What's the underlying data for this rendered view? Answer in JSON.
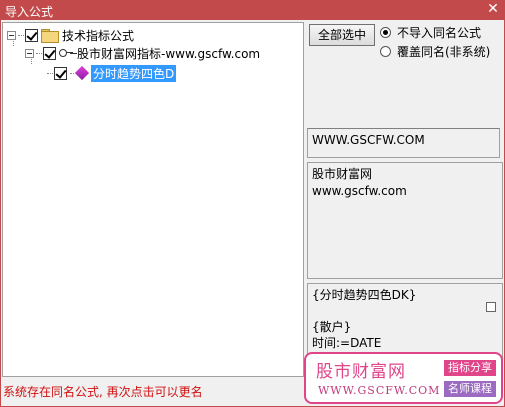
{
  "window": {
    "title": "导入公式",
    "close_glyph": "✕"
  },
  "tree": {
    "items": [
      {
        "label": "技术指标公式",
        "checked": true,
        "icon": "folder-icon"
      },
      {
        "label": "股市财富网指标-www.gscfw.com",
        "checked": true,
        "icon": "key-icon"
      },
      {
        "label": "分时趋势四色D",
        "checked": true,
        "icon": "gem-icon",
        "selected": true
      }
    ]
  },
  "actions": {
    "select_all_label": "全部选中"
  },
  "options": [
    {
      "label": "不导入同名公式",
      "selected": true
    },
    {
      "label": "覆盖同名(非系统)",
      "selected": false
    }
  ],
  "info": {
    "url": "WWW.GSCFW.COM",
    "description": [
      "股市财富网",
      "www.gscfw.com"
    ],
    "code": [
      "{分时趋势四色DK}",
      "",
      "{散户}",
      "时间:=DATE"
    ]
  },
  "status": {
    "message": "系统存在同名公式, 再次点击可以更名"
  },
  "watermark": {
    "name": "股市财富网",
    "url": "WWW.GSCFW.COM",
    "tag1": "指标分享",
    "tag2": "名师课程",
    "accent": "#e0458a"
  }
}
